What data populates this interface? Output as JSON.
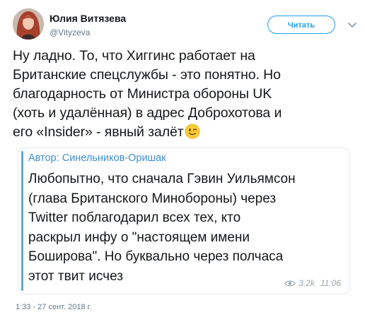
{
  "author": {
    "name": "Юлия Витязева",
    "handle": "@Vityzeva"
  },
  "follow_button_label": "Читать",
  "tweet_lines": [
    "Ну ладно. То, что Хиггинс работает на",
    "Британские спецслужбы - это понятно. Но",
    "благодарность от Министра обороны UK",
    "(хоть и удалённая) в адрес Доброхотова и",
    "его «Insider» - явный залёт"
  ],
  "emoji": "winking-face",
  "quote": {
    "author_label": "Автор: Синельников-Оришак",
    "lines": [
      "Любопытно, что сначала Гэвин Уильямсон",
      "(глава Британского Минобороны) через",
      "Twitter поблагодарил всех тех, кто",
      "раскрыл инфу о \"настоящем имени",
      "Боширова\". Но буквально через полчаса",
      "этот твит исчез"
    ],
    "views": "3.2k",
    "time": "11:06"
  },
  "timestamp": "1:33 - 27 сент. 2018 г.",
  "colors": {
    "accent": "#1da1f2",
    "quote_bar": "#5ea9dd",
    "quote_author": "#3f8fd0",
    "muted": "#657786"
  },
  "icons": [
    "avatar",
    "chevron-down-icon",
    "winking-face-emoji",
    "eye-icon"
  ]
}
